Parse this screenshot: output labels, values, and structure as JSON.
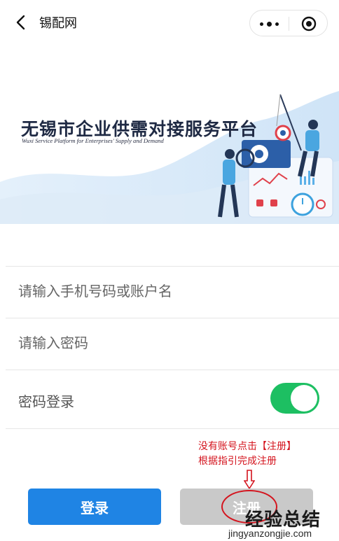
{
  "nav": {
    "title": "锡配网"
  },
  "banner": {
    "title": "无锡市企业供需对接服务平台",
    "subtitle": "Wuxi Service Platform for Enterprises' Supply and Demand"
  },
  "form": {
    "account_placeholder": "请输入手机号码或账户名",
    "password_placeholder": "请输入密码",
    "password_login_label": "密码登录",
    "password_login_enabled": true
  },
  "annotation": {
    "line1": "没有账号点击【注册】",
    "line2": "根据指引完成注册"
  },
  "buttons": {
    "login": "登录",
    "register": "注册"
  },
  "watermark": {
    "text": "经验总结",
    "url": "jingyanzongjie.com"
  },
  "colors": {
    "login_button": "#1f84e4",
    "register_button": "#c9c9c9",
    "toggle_on": "#1dbf62",
    "annotation": "#d4141e"
  }
}
